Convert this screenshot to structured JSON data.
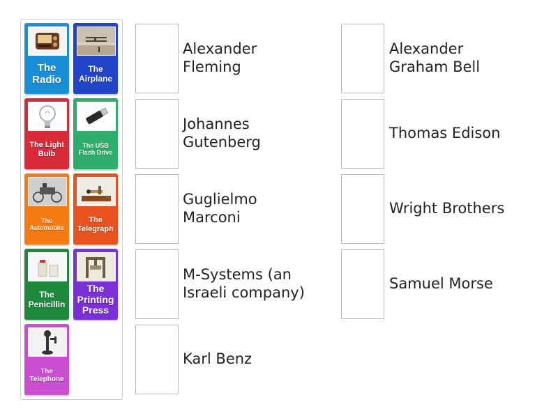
{
  "cards": [
    {
      "label": "The Radio",
      "color": "#1a8fd8",
      "icon": "radio-icon"
    },
    {
      "label": "The Airplane",
      "color": "#2244c8",
      "icon": "airplane-icon"
    },
    {
      "label": "The Light Bulb",
      "color": "#d92a3a",
      "icon": "light-bulb-icon"
    },
    {
      "label": "The USB Flash Drive",
      "color": "#2fae6b",
      "icon": "usb-drive-icon"
    },
    {
      "label": "The Automobile",
      "color": "#f47a14",
      "icon": "automobile-icon"
    },
    {
      "label": "The Telegraph",
      "color": "#e8521e",
      "icon": "telegraph-icon"
    },
    {
      "label": "The Penicillin",
      "color": "#1f8a3e",
      "icon": "penicillin-icon"
    },
    {
      "label": "The Printing Press",
      "color": "#7b2fd6",
      "icon": "printing-press-icon"
    },
    {
      "label": "The Telephone",
      "color": "#c94fd0",
      "icon": "telephone-icon"
    }
  ],
  "targets_left": [
    "Alexander\nFleming",
    "Johannes\nGutenberg",
    "Guglielmo\nMarconi",
    "M-Systems (an\nIsraeli company)",
    "Karl Benz"
  ],
  "targets_right": [
    "Alexander\nGraham Bell",
    "Thomas Edison",
    "Wright Brothers",
    "Samuel Morse"
  ]
}
